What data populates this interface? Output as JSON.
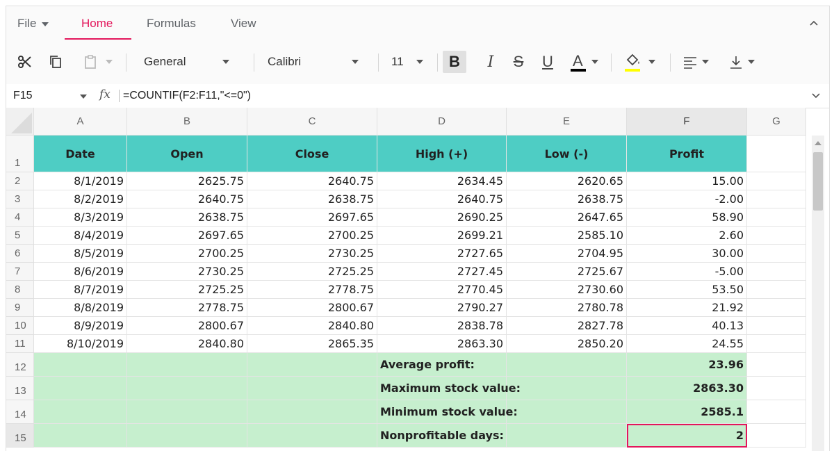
{
  "ribbon": {
    "tabs": [
      {
        "label": "File"
      },
      {
        "label": "Home"
      },
      {
        "label": "Formulas"
      },
      {
        "label": "View"
      }
    ],
    "active_tab": "Home",
    "accent_color": "#e3165b"
  },
  "toolbar": {
    "number_format": "General",
    "font_name": "Calibri",
    "font_size": "11",
    "bold_label": "B",
    "italic_label": "I",
    "strike_label": "S",
    "underline_label": "U",
    "font_color_label": "A",
    "icons": [
      "cut-icon",
      "copy-icon",
      "paste-icon",
      "bold-icon",
      "italic-icon",
      "strikethrough-icon",
      "underline-icon",
      "font-color-icon",
      "fill-color-icon",
      "horizontal-align-icon",
      "vertical-align-icon"
    ]
  },
  "formula_bar": {
    "name_box": "F15",
    "fx_label": "fx",
    "formula": "=COUNTIF(F2:F11,\"<=0\")"
  },
  "grid": {
    "columns": [
      "A",
      "B",
      "C",
      "D",
      "E",
      "F",
      "G"
    ],
    "selected_column": "F",
    "row_numbers": [
      "1",
      "2",
      "3",
      "4",
      "5",
      "6",
      "7",
      "8",
      "9",
      "10",
      "11",
      "12",
      "13",
      "14",
      "15"
    ],
    "header_row": [
      "Date",
      "Open",
      "Close",
      "High (+)",
      "Low (-)",
      "Profit"
    ],
    "rows": [
      [
        "8/1/2019",
        "2625.75",
        "2640.75",
        "2634.45",
        "2620.65",
        "15.00"
      ],
      [
        "8/2/2019",
        "2640.75",
        "2638.75",
        "2640.75",
        "2638.75",
        "-2.00"
      ],
      [
        "8/3/2019",
        "2638.75",
        "2697.65",
        "2690.25",
        "2647.65",
        "58.90"
      ],
      [
        "8/4/2019",
        "2697.65",
        "2700.25",
        "2699.21",
        "2585.10",
        "2.60"
      ],
      [
        "8/5/2019",
        "2700.25",
        "2730.25",
        "2727.65",
        "2704.95",
        "30.00"
      ],
      [
        "8/6/2019",
        "2730.25",
        "2725.25",
        "2727.45",
        "2725.67",
        "-5.00"
      ],
      [
        "8/7/2019",
        "2725.25",
        "2778.75",
        "2770.45",
        "2730.60",
        "53.50"
      ],
      [
        "8/8/2019",
        "2778.75",
        "2800.67",
        "2790.27",
        "2780.78",
        "21.92"
      ],
      [
        "8/9/2019",
        "2800.67",
        "2840.80",
        "2838.78",
        "2827.78",
        "40.13"
      ],
      [
        "8/10/2019",
        "2840.80",
        "2865.35",
        "2863.30",
        "2850.20",
        "24.55"
      ]
    ],
    "summary": [
      {
        "label": "Average profit:",
        "value": "23.96"
      },
      {
        "label": "Maximum stock value:",
        "value": "2863.30"
      },
      {
        "label": "Minimum stock value:",
        "value": "2585.1"
      },
      {
        "label": "Nonprofitable days:",
        "value": "2"
      }
    ],
    "header_fill": "#4ecdc4",
    "summary_fill": "#c6efce"
  }
}
